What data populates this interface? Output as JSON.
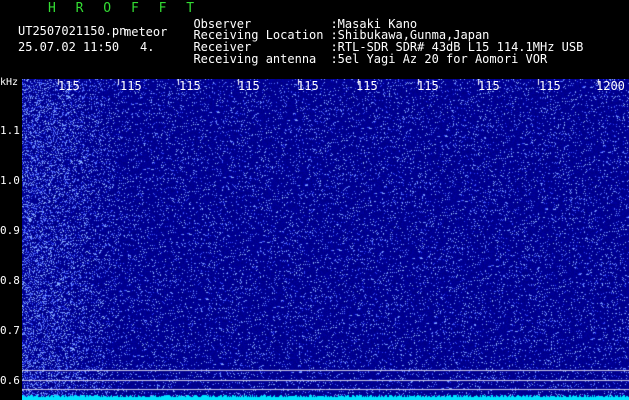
{
  "app": {
    "title": "H R O F F T",
    "filename": "UT2507021150.pn",
    "mode": "meteor",
    "datetime": "25.07.02 11:50",
    "index": "4."
  },
  "info": [
    {
      "label": "Observer",
      "value": ":Masaki Kano"
    },
    {
      "label": "Receiving Location",
      "value": ":Shibukawa,Gunma,Japan"
    },
    {
      "label": "Receiver",
      "value": ":RTL-SDR SDR# 43dB L15 114.1MHz USB"
    },
    {
      "label": "Receiving antenna",
      "value": ":5el Yagi Az 20 for Aomori VOR"
    }
  ],
  "axes": {
    "y_unit": "kHz",
    "y_ticks": [
      "1.1",
      "1.0",
      "0.9",
      "0.8",
      "0.7",
      "0.6"
    ],
    "x_ticks": [
      "115",
      "115",
      "115",
      "115",
      "115",
      "115",
      "115",
      "115",
      "115",
      "1200"
    ]
  },
  "colors": {
    "background": "#000000",
    "spectrum_base": "#00008a",
    "noise_dot": "#4a6bff",
    "baseline": "#00e0ff",
    "title": "#33dd33"
  }
}
